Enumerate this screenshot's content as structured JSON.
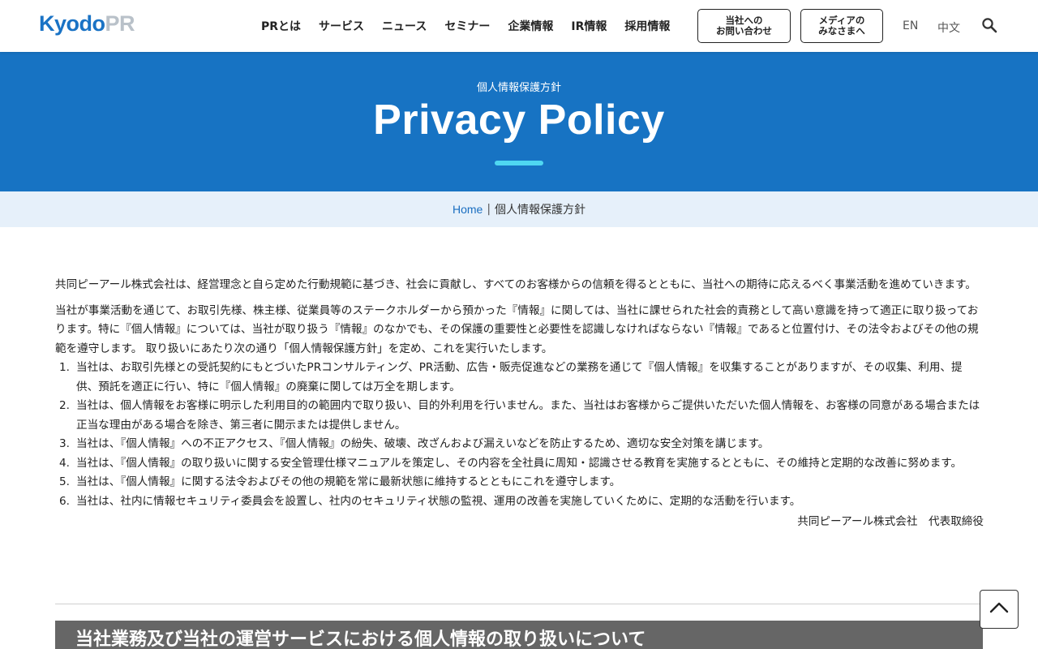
{
  "header": {
    "logo_main": "Kyodo",
    "logo_accent": "PR",
    "nav": [
      "PRとは",
      "サービス",
      "ニュース",
      "セミナー",
      "企業情報",
      "IR情報",
      "採用情報"
    ],
    "contact_button": [
      "当社への",
      "お問い合わせ"
    ],
    "media_button": [
      "メディアの",
      "みなさまへ"
    ],
    "lang_en": "EN",
    "lang_zh": "中文",
    "search_icon": "search-icon"
  },
  "hero": {
    "subtitle": "個人情報保護方針",
    "title": "Privacy Policy",
    "accent_color": "#4fd7f1",
    "background": "#1773c3"
  },
  "breadcrumb": {
    "home": "Home",
    "separator": "|",
    "current": "個人情報保護方針"
  },
  "content": {
    "intro": "共同ピーアール株式会社は、経営理念と自ら定めた行動規範に基づき、社会に貢献し、すべてのお客様からの信頼を得るとともに、当社への期待に応えるべく事業活動を進めていきます。",
    "lead": "当社が事業活動を通じて、お取引先様、株主様、従業員等のステークホルダーから預かった『情報』に関しては、当社に課せられた社会的責務として高い意識を持って適正に取り扱っております。特に『個人情報』については、当社が取り扱う『情報』のなかでも、その保護の重要性と必要性を認識しなければならない『情報』であると位置付け、その法令およびその他の規範を遵守します。 取り扱いにあたり次の通り「個人情報保護方針」を定め、これを実行いたします。",
    "items": [
      {
        "num": "1.",
        "text": "当社は、お取引先様との受託契約にもとづいたPRコンサルティング、PR活動、広告・販売促進などの業務を通じて『個人情報』を収集することがありますが、その収集、利用、提供、預託を適正に行い、特に『個人情報』の廃棄に関しては万全を期します。"
      },
      {
        "num": "2.",
        "text": "当社は、個人情報をお客様に明示した利用目的の範囲内で取り扱い、目的外利用を行いません。また、当社はお客様からご提供いただいた個人情報を、お客様の同意がある場合または正当な理由がある場合を除き、第三者に開示または提供しません。"
      },
      {
        "num": "3.",
        "text": "当社は、『個人情報』への不正アクセス、『個人情報』の紛失、破壊、改ざんおよび漏えいなどを防止するため、適切な安全対策を講じます。"
      },
      {
        "num": "4.",
        "text": "当社は、『個人情報』の取り扱いに関する安全管理仕様マニュアルを策定し、その内容を全社員に周知・認識させる教育を実施するとともに、その維持と定期的な改善に努めます。"
      },
      {
        "num": "5.",
        "text": "当社は、『個人情報』に関する法令およびその他の規範を常に最新状態に維持するとともにこれを遵守します。"
      },
      {
        "num": "6.",
        "text": "当社は、社内に情報セキュリティ委員会を設置し、社内のセキュリティ状態の監視、運用の改善を実施していくために、定期的な活動を行います。"
      }
    ],
    "signature": "共同ピーアール株式会社　代表取締役"
  },
  "section": {
    "heading": "当社業務及び当社の運営サービスにおける個人情報の取り扱いについて"
  },
  "back_to_top": {
    "icon": "chevron-up-icon"
  }
}
